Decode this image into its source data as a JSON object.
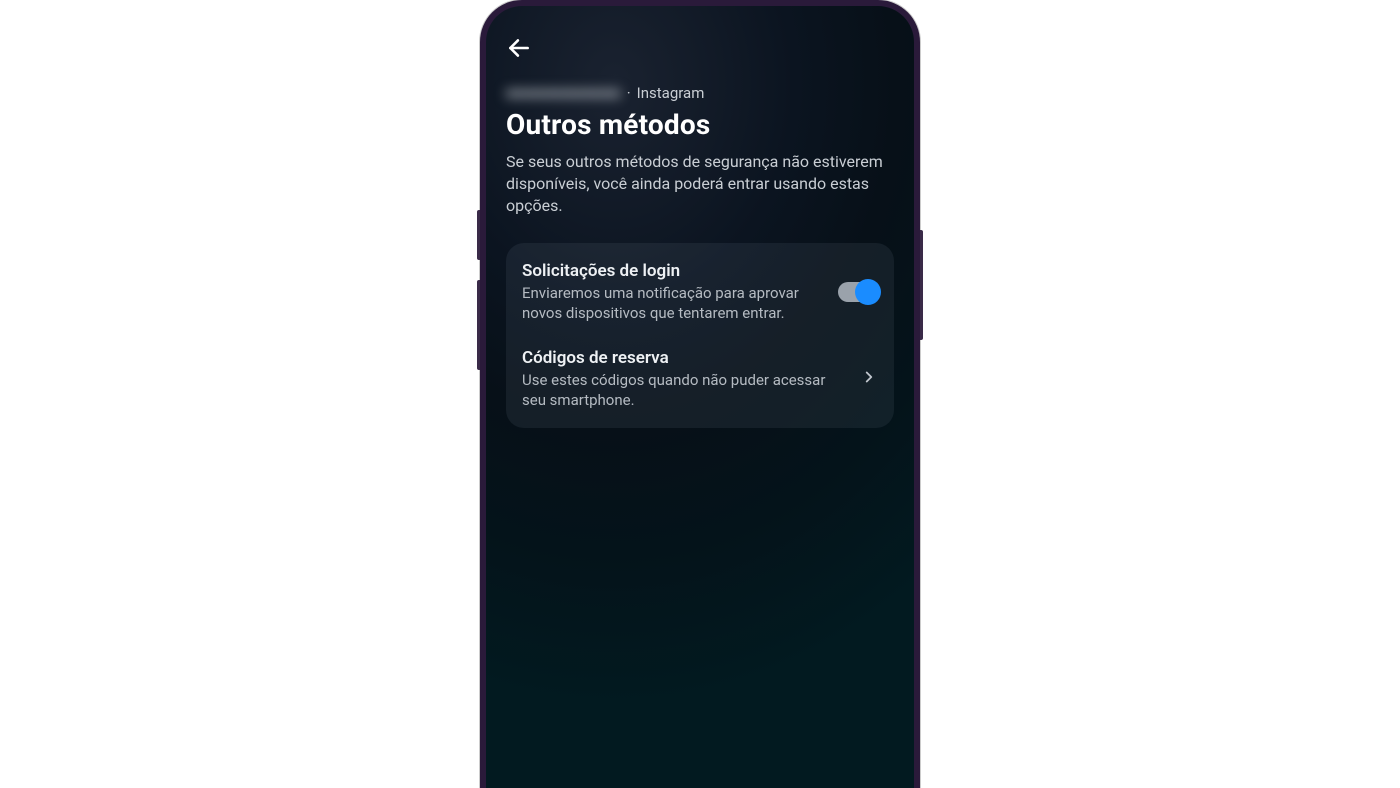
{
  "header": {
    "account_name": "■■■■■■■■■■■■",
    "separator": "·",
    "platform": "Instagram",
    "title": "Outros métodos",
    "subtitle": "Se seus outros métodos de segurança não estiverem disponíveis, você ainda poderá entrar usando estas opções."
  },
  "options": {
    "login_requests": {
      "title": "Solicitações de login",
      "description": "Enviaremos uma notificação para aprovar novos dispositivos que tentarem entrar.",
      "enabled": true
    },
    "backup_codes": {
      "title": "Códigos de reserva",
      "description": "Use estes códigos quando não puder acessar seu smartphone."
    }
  }
}
